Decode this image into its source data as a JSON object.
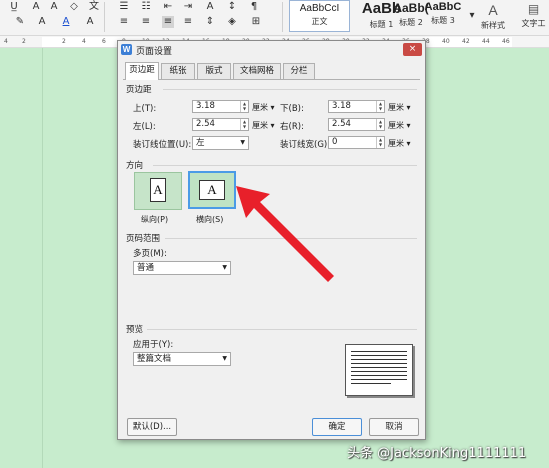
{
  "ribbon": {
    "styles": [
      {
        "sample": "AaBbCcI",
        "name": "正文"
      },
      {
        "sample": "AaBb",
        "name": "标题 1"
      },
      {
        "sample": "AaBb(",
        "name": "标题 2"
      },
      {
        "sample": "AaBbC",
        "name": "标题 3"
      }
    ],
    "new_style_label": "新样式",
    "text_tools_label": "文字工"
  },
  "ruler": {
    "ticks": [
      "4",
      "2",
      "2",
      "4",
      "6",
      "8",
      "10",
      "12",
      "14",
      "16",
      "18",
      "20",
      "22",
      "24",
      "26",
      "28",
      "30",
      "32",
      "34",
      "36",
      "38",
      "40",
      "42",
      "44",
      "46"
    ]
  },
  "dialog": {
    "app_icon": "W",
    "title": "页面设置",
    "close": "×",
    "tabs": [
      "页边距",
      "纸张",
      "版式",
      "文档网格",
      "分栏"
    ],
    "active_tab": 0,
    "margins": {
      "section": "页边距",
      "top_label": "上(T):",
      "top_value": "3.18",
      "top_unit": "厘米",
      "bottom_label": "下(B):",
      "bottom_value": "3.18",
      "bottom_unit": "厘米",
      "left_label": "左(L):",
      "left_value": "2.54",
      "left_unit": "厘米",
      "right_label": "右(R):",
      "right_value": "2.54",
      "right_unit": "厘米",
      "gutter_pos_label": "装订线位置(U):",
      "gutter_pos_value": "左",
      "gutter_width_label": "装订线宽(G):",
      "gutter_width_value": "0",
      "gutter_width_unit": "厘米"
    },
    "orientation": {
      "section": "方向",
      "portrait_label": "纵向(P)",
      "landscape_label": "横向(S)",
      "selected": "landscape"
    },
    "pages": {
      "section": "页码范围",
      "multiple_label": "多页(M):",
      "multiple_value": "普通"
    },
    "preview": {
      "section": "预览",
      "apply_label": "应用于(Y):",
      "apply_value": "整篇文档"
    },
    "buttons": {
      "default": "默认(D)...",
      "ok": "确定",
      "cancel": "取消"
    }
  },
  "annotation": {
    "arrow_color": "#e8202a"
  },
  "watermark": "头条 @JacksonKing1111111"
}
